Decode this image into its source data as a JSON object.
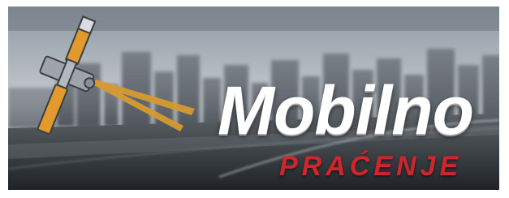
{
  "logo": {
    "title": "Mobilno",
    "subtitle": "PRAĆENJE",
    "icon": "satellite-icon"
  },
  "colors": {
    "title": "#ffffff",
    "subtitle": "#d0262b",
    "satellite_panel": "#e39a2c",
    "beam": "#d69a32"
  }
}
